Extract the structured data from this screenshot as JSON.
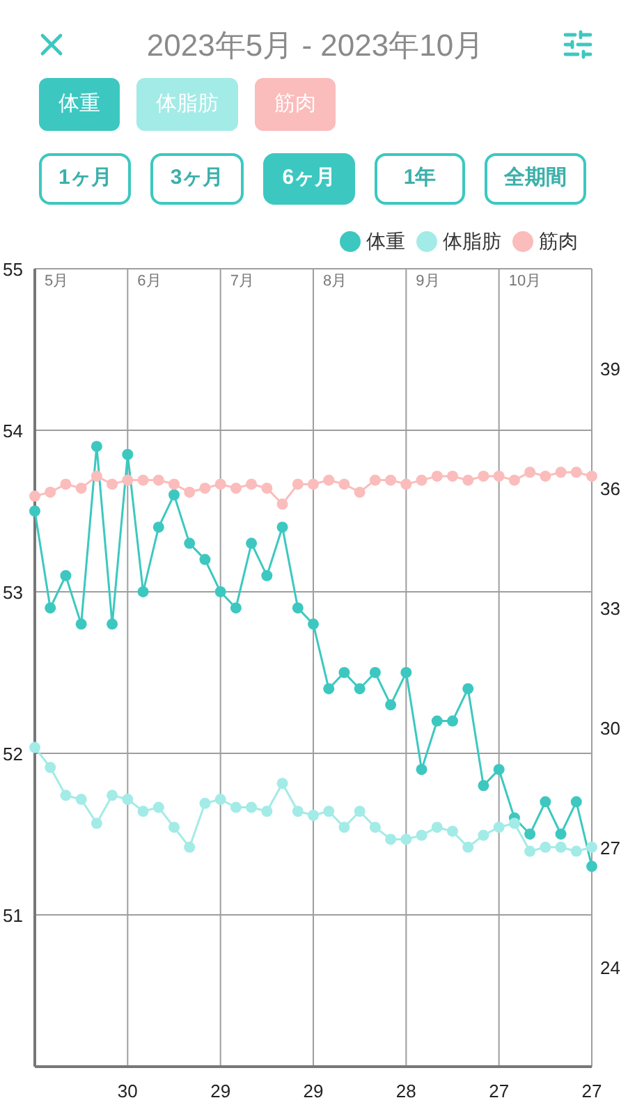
{
  "header": {
    "title": "2023年5月 - 2023年10月"
  },
  "metric_chips": [
    {
      "label": "体重",
      "color": "#3cc8c0",
      "on": true
    },
    {
      "label": "体脂肪",
      "color": "#a3ebe6",
      "on": true
    },
    {
      "label": "筋肉",
      "color": "#fbbcbc",
      "on": true
    }
  ],
  "periods": [
    {
      "label": "1ヶ月",
      "selected": false
    },
    {
      "label": "3ヶ月",
      "selected": false
    },
    {
      "label": "6ヶ月",
      "selected": true
    },
    {
      "label": "1年",
      "selected": false
    },
    {
      "label": "全期間",
      "selected": false
    }
  ],
  "chart": {
    "chart_data": {
      "type": "line",
      "categories": [
        null,
        null,
        null,
        null,
        null,
        null,
        "30",
        null,
        null,
        null,
        null,
        null,
        "29",
        null,
        null,
        null,
        null,
        null,
        "29",
        null,
        null,
        null,
        null,
        null,
        "28",
        null,
        null,
        null,
        null,
        null,
        "27",
        null,
        null,
        null,
        null,
        null,
        "27"
      ],
      "grid": true,
      "ylim": [
        50.06,
        55
      ],
      "y2lim": [
        21.5,
        41.5
      ],
      "yticks": [
        51,
        52,
        53,
        54,
        55
      ],
      "y2ticks": [
        24,
        27,
        30,
        33,
        36,
        39
      ],
      "annotations": [
        "5月",
        "6月",
        "7月",
        "8月",
        "9月",
        "10月"
      ],
      "series": [
        {
          "name": "体重",
          "color": "#3cc8c0",
          "marker": "circle",
          "values": [
            53.5,
            52.9,
            53.1,
            52.8,
            53.9,
            52.8,
            53.85,
            53.0,
            53.4,
            53.6,
            53.3,
            53.2,
            53.0,
            52.9,
            53.3,
            53.1,
            53.4,
            52.9,
            52.8,
            52.4,
            52.5,
            52.4,
            52.5,
            52.3,
            52.5,
            51.9,
            52.2,
            52.2,
            52.4,
            51.8,
            51.9,
            51.6,
            51.5,
            51.7,
            51.5,
            51.7,
            51.3
          ]
        },
        {
          "name": "体脂肪",
          "color": "#a3ebe6",
          "axis": "y2",
          "marker": "circle",
          "values": [
            29.5,
            29.0,
            28.3,
            28.2,
            27.6,
            28.3,
            28.2,
            27.9,
            28.0,
            27.5,
            27.0,
            28.1,
            28.2,
            28.0,
            28.0,
            27.9,
            28.6,
            27.9,
            27.8,
            27.9,
            27.5,
            27.9,
            27.5,
            27.2,
            27.2,
            27.3,
            27.5,
            27.4,
            27.0,
            27.3,
            27.5,
            27.6,
            26.9,
            27.0,
            27.0,
            26.9,
            27.0
          ]
        },
        {
          "name": "筋肉",
          "color": "#fbbcbc",
          "axis": "y2",
          "marker": "circle",
          "values": [
            35.8,
            35.9,
            36.1,
            36.0,
            36.3,
            36.1,
            36.2,
            36.2,
            36.2,
            36.1,
            35.9,
            36.0,
            36.1,
            36.0,
            36.1,
            36.0,
            35.6,
            36.1,
            36.1,
            36.2,
            36.1,
            35.9,
            36.2,
            36.2,
            36.1,
            36.2,
            36.3,
            36.3,
            36.2,
            36.3,
            36.3,
            36.2,
            36.4,
            36.3,
            36.4,
            36.4,
            36.3
          ]
        }
      ]
    }
  }
}
